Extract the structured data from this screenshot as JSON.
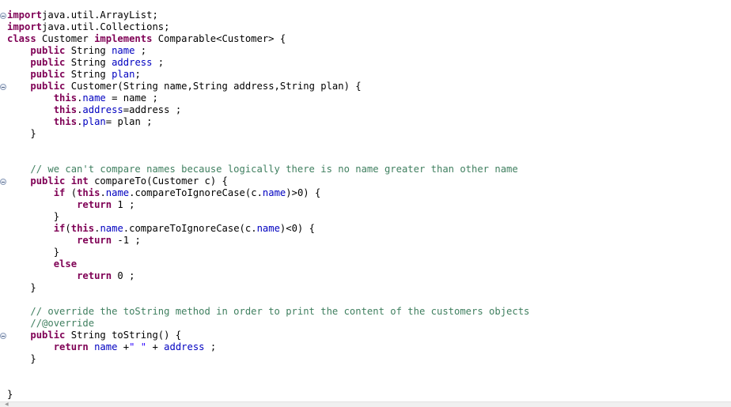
{
  "editor": {
    "lines": [
      [
        [
          "kw",
          "import"
        ],
        [
          "",
          "java.util.ArrayList;"
        ]
      ],
      [
        [
          "kw",
          "import"
        ],
        [
          "",
          "java.util.Collections;"
        ]
      ],
      [
        [
          "kw",
          "class"
        ],
        [
          "",
          " Customer "
        ],
        [
          "kw",
          "implements"
        ],
        [
          "",
          " Comparable<Customer> {"
        ]
      ],
      [
        [
          "",
          "    "
        ],
        [
          "kw",
          "public"
        ],
        [
          "",
          " String "
        ],
        [
          "fld",
          "name"
        ],
        [
          "",
          " ;"
        ]
      ],
      [
        [
          "",
          "    "
        ],
        [
          "kw",
          "public"
        ],
        [
          "",
          " String "
        ],
        [
          "fld",
          "address"
        ],
        [
          "",
          " ;"
        ]
      ],
      [
        [
          "",
          "    "
        ],
        [
          "kw",
          "public"
        ],
        [
          "",
          " String "
        ],
        [
          "fld",
          "plan"
        ],
        [
          "",
          ";"
        ]
      ],
      [
        [
          "",
          "    "
        ],
        [
          "kw",
          "public"
        ],
        [
          "",
          " Customer(String name,String address,String plan) {"
        ]
      ],
      [
        [
          "",
          "        "
        ],
        [
          "kw",
          "this"
        ],
        [
          "",
          "."
        ],
        [
          "fld",
          "name"
        ],
        [
          "",
          " = name ;"
        ]
      ],
      [
        [
          "",
          "        "
        ],
        [
          "kw",
          "this"
        ],
        [
          "",
          "."
        ],
        [
          "fld",
          "address"
        ],
        [
          "",
          "=address ;"
        ]
      ],
      [
        [
          "",
          "        "
        ],
        [
          "kw",
          "this"
        ],
        [
          "",
          "."
        ],
        [
          "fld",
          "plan"
        ],
        [
          "",
          "= plan ;"
        ]
      ],
      [
        [
          "",
          "    }"
        ]
      ],
      [],
      [],
      [
        [
          "",
          "    "
        ],
        [
          "cmt",
          "// we can't compare names because logically there is no name greater than other name"
        ]
      ],
      [
        [
          "",
          "    "
        ],
        [
          "kw",
          "public"
        ],
        [
          "",
          ""
        ],
        [
          "kw",
          " int"
        ],
        [
          "",
          " compareTo(Customer c) {"
        ]
      ],
      [
        [
          "",
          "        "
        ],
        [
          "kw",
          "if"
        ],
        [
          "",
          " ("
        ],
        [
          "kw",
          "this"
        ],
        [
          "",
          "."
        ],
        [
          "fld",
          "name"
        ],
        [
          "",
          ".compareToIgnoreCase(c."
        ],
        [
          "fld",
          "name"
        ],
        [
          "",
          ")>0) {"
        ]
      ],
      [
        [
          "",
          "            "
        ],
        [
          "kw",
          "return"
        ],
        [
          "",
          " 1 ;"
        ]
      ],
      [
        [
          "",
          "        }"
        ]
      ],
      [
        [
          "",
          "        "
        ],
        [
          "kw",
          "if"
        ],
        [
          "",
          "("
        ],
        [
          "kw",
          "this"
        ],
        [
          "",
          "."
        ],
        [
          "fld",
          "name"
        ],
        [
          "",
          ".compareToIgnoreCase(c."
        ],
        [
          "fld",
          "name"
        ],
        [
          "",
          ")<0) {"
        ]
      ],
      [
        [
          "",
          "            "
        ],
        [
          "kw",
          "return"
        ],
        [
          "",
          " -1 ;"
        ]
      ],
      [
        [
          "",
          "        }"
        ]
      ],
      [
        [
          "",
          "        "
        ],
        [
          "kw",
          "else"
        ]
      ],
      [
        [
          "",
          "            "
        ],
        [
          "kw",
          "return"
        ],
        [
          "",
          " 0 ;"
        ]
      ],
      [
        [
          "",
          "    }"
        ]
      ],
      [],
      [
        [
          "",
          "    "
        ],
        [
          "cmt",
          "// override the toString method in order to print the content of the customers objects"
        ]
      ],
      [
        [
          "",
          "    "
        ],
        [
          "cmt",
          "//@override"
        ]
      ],
      [
        [
          "",
          "    "
        ],
        [
          "kw",
          "public"
        ],
        [
          "",
          " String toString() {"
        ]
      ],
      [
        [
          "",
          "        "
        ],
        [
          "kw",
          "return"
        ],
        [
          "",
          " "
        ],
        [
          "fld",
          "name"
        ],
        [
          "",
          " +"
        ],
        [
          "str",
          "\" \""
        ],
        [
          "",
          " + "
        ],
        [
          "fld",
          "address"
        ],
        [
          "",
          " ;"
        ]
      ],
      [
        [
          "",
          "    }"
        ]
      ],
      [],
      [],
      [
        [
          "",
          "}"
        ]
      ]
    ],
    "fold_lines": [
      0,
      6,
      14,
      27
    ],
    "colors": {
      "keyword": "#7f0055",
      "field": "#0000c0",
      "comment": "#3f7f5f",
      "string": "#2a00ff",
      "background": "#ffffff"
    }
  }
}
